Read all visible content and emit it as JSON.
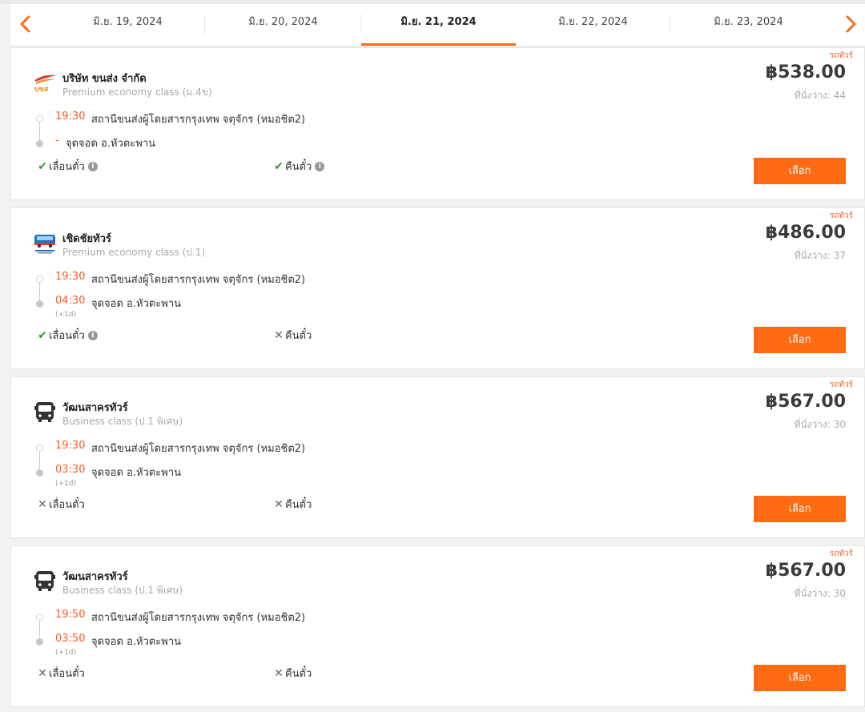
{
  "date_nav": {
    "dates": [
      "มิ.ย. 19, 2024",
      "มิ.ย. 20, 2024",
      "มิ.ย. 21, 2024",
      "มิ.ย. 22, 2024",
      "มิ.ย. 23, 2024"
    ],
    "active_index": 2,
    "prev_icon": "chevron-left-icon",
    "next_icon": "chevron-right-icon"
  },
  "colors": {
    "accent": "#ff6a13",
    "check": "#2e9b2e"
  },
  "trips": [
    {
      "tag": "รถทัวร์",
      "operator": "บริษัท ขนส่ง จำกัด",
      "class": "Premium economy class (ม.4ข)",
      "logo": "bks-logo",
      "price": "฿538.00",
      "seats": "ที่นั่งว่าง: 44",
      "depart_time": "19:30",
      "depart_place": "สถานีขนส่งผู้โดยสารกรุงเทพ จตุจักร (หมอชิต2)",
      "arrive_time": "-",
      "arrive_place": "จุดจอด อ.หัวตะพาน",
      "plus_day": "",
      "change_label": "เลื่อนตั๋ว",
      "change_allowed": true,
      "refund_label": "คืนตั๋ว",
      "refund_allowed": true,
      "select_label": "เลือก"
    },
    {
      "tag": "รถทัวร์",
      "operator": "เชิดชัยทัวร์",
      "class": "Premium economy class (ป.1)",
      "logo": "cherdchai-logo",
      "price": "฿486.00",
      "seats": "ที่นั่งว่าง: 37",
      "depart_time": "19:30",
      "depart_place": "สถานีขนส่งผู้โดยสารกรุงเทพ จตุจักร (หมอชิต2)",
      "arrive_time": "04:30",
      "arrive_place": "จุดจอด อ.หัวตะพาน",
      "plus_day": "(+1d)",
      "change_label": "เลื่อนตั๋ว",
      "change_allowed": true,
      "refund_label": "คืนตั๋ว",
      "refund_allowed": false,
      "select_label": "เลือก"
    },
    {
      "tag": "รถทัวร์",
      "operator": "วัฒนสาครทัวร์",
      "class": "Business class (ป.1 พิเศษ)",
      "logo": "bus-icon",
      "price": "฿567.00",
      "seats": "ที่นั่งว่าง: 30",
      "depart_time": "19:30",
      "depart_place": "สถานีขนส่งผู้โดยสารกรุงเทพ จตุจักร (หมอชิต2)",
      "arrive_time": "03:30",
      "arrive_place": "จุดจอด อ.หัวตะพาน",
      "plus_day": "(+1d)",
      "change_label": "เลื่อนตั๋ว",
      "change_allowed": false,
      "refund_label": "คืนตั๋ว",
      "refund_allowed": false,
      "select_label": "เลือก"
    },
    {
      "tag": "รถทัวร์",
      "operator": "วัฒนสาครทัวร์",
      "class": "Business class (ป.1 พิเศษ)",
      "logo": "bus-icon",
      "price": "฿567.00",
      "seats": "ที่นั่งว่าง: 30",
      "depart_time": "19:50",
      "depart_place": "สถานีขนส่งผู้โดยสารกรุงเทพ จตุจักร (หมอชิต2)",
      "arrive_time": "03:50",
      "arrive_place": "จุดจอด อ.หัวตะพาน",
      "plus_day": "(+1d)",
      "change_label": "เลื่อนตั๋ว",
      "change_allowed": false,
      "refund_label": "คืนตั๋ว",
      "refund_allowed": false,
      "select_label": "เลือก"
    }
  ]
}
